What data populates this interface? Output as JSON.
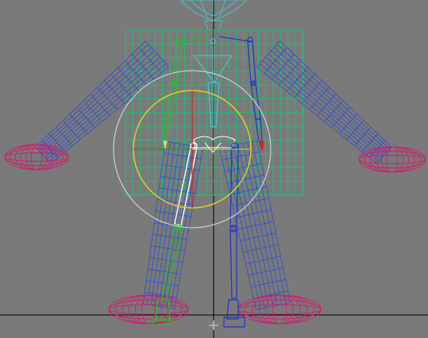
{
  "viewport": {
    "view_label": "",
    "background": "#7a7a7a",
    "colors": {
      "torso_mesh": "#1fbf7a",
      "limb_mesh": "#2e4fd0",
      "foot_hand_mesh": "#d21a6e",
      "head_mesh": "#3fd0e0",
      "left_chain": "#22c322",
      "right_chain": "#2233cc",
      "selected_bone": "#ffffff",
      "gizmo_ring": "#e6d21a",
      "gizmo_outer": "#d8d8d8",
      "gizmo_axis_x": "#d42020",
      "gizmo_axis_y": "#1a9e1a",
      "world_axis": "#000000"
    }
  }
}
